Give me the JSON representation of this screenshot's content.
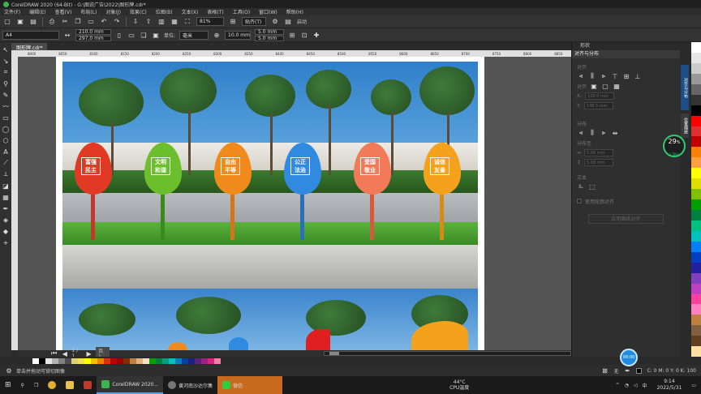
{
  "window": {
    "title": "CorelDRAW 2020 (64-Bit) - G:\\图说广告\\2022\\图形牌.cdr*"
  },
  "menu": [
    "文件(F)",
    "编辑(E)",
    "查看(V)",
    "布局(L)",
    "对象(J)",
    "效果(C)",
    "位图(B)",
    "文本(X)",
    "表格(T)",
    "工具(O)",
    "窗口(W)",
    "帮助(H)"
  ],
  "toolbar": {
    "zoom": "81%",
    "snap_label": "贴齐(T)",
    "launch_label": "启动"
  },
  "propbar": {
    "page_size": "A4",
    "width": "210.0 mm",
    "height": "297.0 mm",
    "unit_label": "单位:",
    "unit": "毫米",
    "nudge": "10.0 mm",
    "dup_x": "5.0 mm",
    "dup_y": "5.0 mm"
  },
  "doc_tab": "图形牌.cdr*",
  "ruler_ticks": [
    "8000",
    "8050",
    "8100",
    "8150",
    "8200",
    "8250",
    "8300",
    "8350",
    "8400",
    "8450",
    "8500",
    "8550",
    "8600",
    "8650",
    "8700",
    "8750",
    "8800",
    "8850",
    "8900",
    "8950"
  ],
  "signs": [
    {
      "line1": "富强",
      "line2": "民主",
      "color": "#e03a24",
      "pole": "#c0392b"
    },
    {
      "line1": "文明",
      "line2": "和谐",
      "color": "#6cbf2c",
      "pole": "#3a8a1c"
    },
    {
      "line1": "自由",
      "line2": "平等",
      "color": "#f08a1c",
      "pole": "#d9731a"
    },
    {
      "line1": "公正",
      "line2": "法治",
      "color": "#2f8ae0",
      "pole": "#2a6fb8"
    },
    {
      "line1": "爱国",
      "line2": "敬业",
      "color": "#f27a58",
      "pole": "#d65a3a"
    },
    {
      "line1": "诚信",
      "line2": "友善",
      "color": "#f4a21c",
      "pole": "#d88b14"
    }
  ],
  "page_nav": {
    "page_tab": "页 1",
    "counter": "1 / 1"
  },
  "status": {
    "hint": "单击并拖动可锁切图像",
    "fill": "无",
    "color_readout": "C: 0 M: 0 Y: 0 K: 100"
  },
  "right_panel": {
    "shape_tab": "形状",
    "panel_title": "对齐与分布",
    "align_label": "对齐",
    "align_to_label": "对齐",
    "x_value": "105.0 mm",
    "y_value": "148.5 mm",
    "distribute_label": "分布",
    "distribute_to_label": "分布至",
    "horiz_value": "5.08 mm",
    "vert_value": "5.08 mm",
    "text_label": "文本",
    "use_outline": "使用轮廓对齐",
    "apply_button": "应用图纸对齐"
  },
  "vertical_tabs": [
    "对齐与分布",
    "位置缩放"
  ],
  "cpu": {
    "percent": "29",
    "unit": "%",
    "rate": "1.5K/s"
  },
  "clock_badge": "00:00",
  "taskbar": {
    "apps": [
      "CorelDRAW 2020...",
      "黄河南沙达尔集",
      "微信"
    ],
    "weather_temp": "44°C",
    "weather_label": "CPU温度",
    "time": "9:14",
    "date": "2022/5/31"
  },
  "colors": {
    "palette": [
      "#ffffff",
      "#000000",
      "#e6e6e6",
      "#b3b3b3",
      "#808080",
      "#4d4d4d",
      "#e0d070",
      "#f0e060",
      "#ffff00",
      "#f5c000",
      "#f08000",
      "#e03000",
      "#c00000",
      "#a00000",
      "#803000",
      "#c08040",
      "#e0b080",
      "#ffe0c0",
      "#00a000",
      "#008040",
      "#00a080",
      "#00c0c0",
      "#0080c0",
      "#0040a0",
      "#202080",
      "#602080",
      "#a02080",
      "#e02080",
      "#f080a0"
    ],
    "vertical_palette": [
      "#ffffff",
      "#e6e6e6",
      "#cccccc",
      "#999999",
      "#666666",
      "#333333",
      "#000000",
      "#ff0000",
      "#e03030",
      "#c00000",
      "#ff8000",
      "#ffa040",
      "#ffff00",
      "#e0e000",
      "#80c000",
      "#00a000",
      "#008040",
      "#00c080",
      "#00c0c0",
      "#0080ff",
      "#0040c0",
      "#2020a0",
      "#8040c0",
      "#c040c0",
      "#ff40a0",
      "#ff80c0",
      "#c08040",
      "#806040",
      "#604020",
      "#ffe0a0"
    ]
  }
}
